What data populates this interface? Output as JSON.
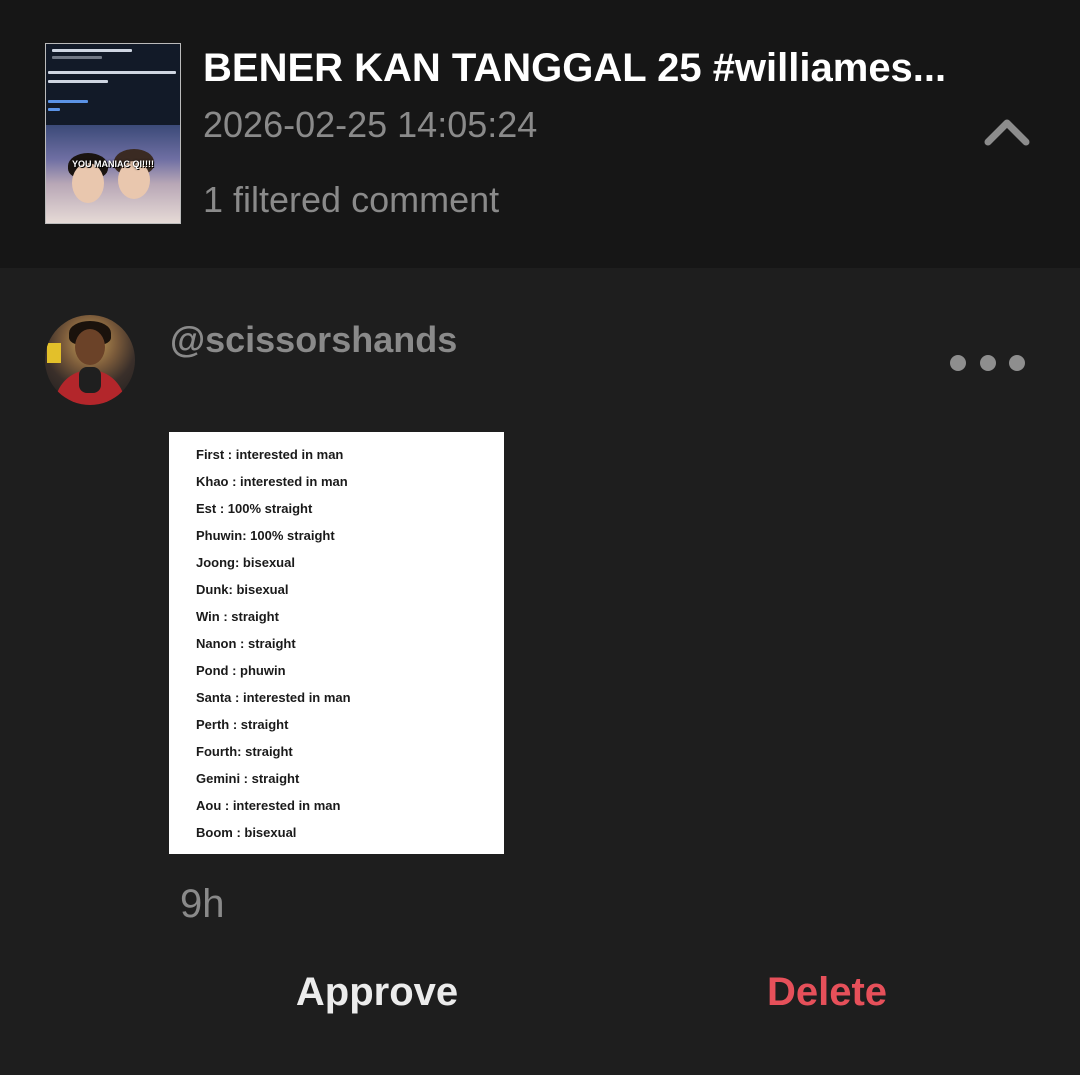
{
  "video": {
    "title": "BENER KAN TANGGAL 25 #williames...",
    "date": "2026-02-25 14:05:24",
    "filtered_count_label": "1 filtered comment",
    "thumbnail_caption": "YOU MANIAC QI!!!!",
    "collapse_icon": "chevron-up-icon"
  },
  "comment": {
    "username": "@scissorshands",
    "time": "9h",
    "more_icon": "more-horizontal-icon",
    "image_lines": [
      "First : interested in man",
      "Khao : interested in man",
      "Est : 100% straight",
      "Phuwin: 100% straight",
      "Joong: bisexual",
      "Dunk: bisexual",
      "Win : straight",
      "Nanon : straight",
      "Pond : phuwin",
      "Santa : interested in man",
      "Perth : straight",
      "Fourth: straight",
      "Gemini : straight",
      "Aou : interested in man",
      "Boom : bisexual"
    ]
  },
  "actions": {
    "approve_label": "Approve",
    "delete_label": "Delete",
    "delete_color": "#e6505a"
  },
  "colors": {
    "background": "#1e1e1e",
    "header_background": "#161616",
    "secondary_text": "#8a8a8a"
  }
}
